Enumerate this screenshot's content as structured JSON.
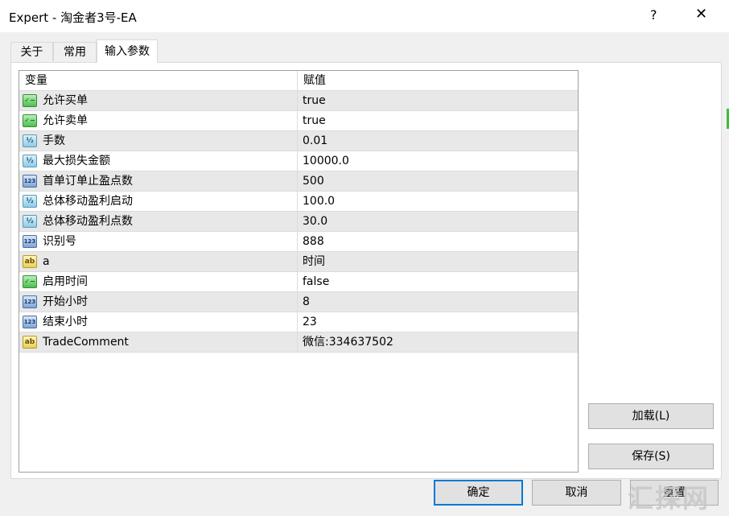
{
  "window": {
    "title": "Expert - 淘金者3号-EA",
    "help_label": "?",
    "close_label": "✕"
  },
  "tabs": [
    {
      "label": "关于",
      "active": false
    },
    {
      "label": "常用",
      "active": false
    },
    {
      "label": "输入参数",
      "active": true
    }
  ],
  "grid": {
    "headers": {
      "variable": "变量",
      "value": "赋值"
    },
    "rows": [
      {
        "icon": "bool-type-icon",
        "name": "允许买单",
        "value": "true"
      },
      {
        "icon": "bool-type-icon",
        "name": "允许卖单",
        "value": "true"
      },
      {
        "icon": "double-type-icon",
        "name": "手数",
        "value": "0.01"
      },
      {
        "icon": "double-type-icon",
        "name": "最大损失金额",
        "value": "10000.0"
      },
      {
        "icon": "int-type-icon",
        "name": "首单订单止盈点数",
        "value": "500"
      },
      {
        "icon": "double-type-icon",
        "name": "总体移动盈利启动",
        "value": "100.0"
      },
      {
        "icon": "double-type-icon",
        "name": "总体移动盈利点数",
        "value": "30.0"
      },
      {
        "icon": "int-type-icon",
        "name": "识别号",
        "value": "888"
      },
      {
        "icon": "string-type-icon",
        "name": "a",
        "value": "时间"
      },
      {
        "icon": "bool-type-icon",
        "name": "启用时间",
        "value": "false"
      },
      {
        "icon": "int-type-icon",
        "name": "开始小时",
        "value": "8"
      },
      {
        "icon": "int-type-icon",
        "name": "结束小时",
        "value": "23"
      },
      {
        "icon": "string-type-icon",
        "name": "TradeComment",
        "value": "微信:334637502"
      }
    ]
  },
  "icon_glyphs": {
    "bool": "✓∼",
    "double": "½",
    "int": "123",
    "string": "ab"
  },
  "side_buttons": {
    "load_label": "加载(L)",
    "save_label": "保存(S)"
  },
  "footer_buttons": {
    "ok_label": "确定",
    "cancel_label": "取消",
    "reset_label": "重置"
  },
  "watermark": "汇探网"
}
